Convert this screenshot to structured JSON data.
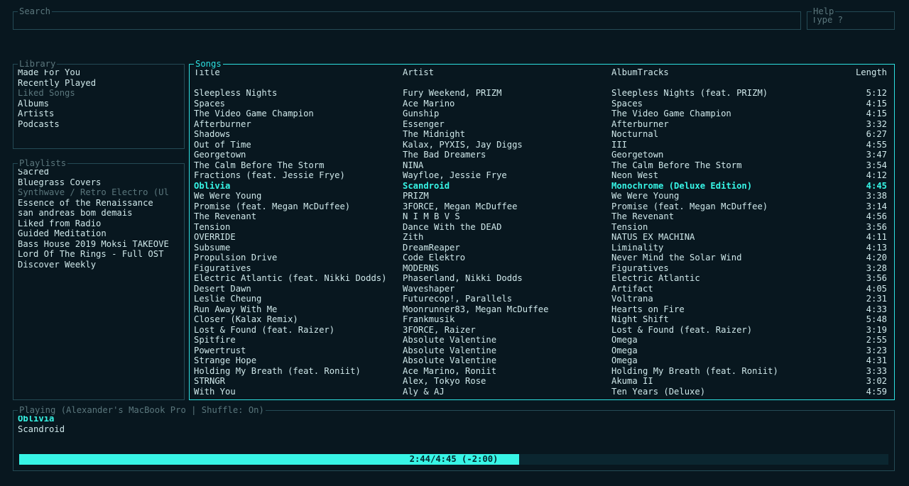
{
  "search": {
    "title": "Search",
    "value": ""
  },
  "help": {
    "title": "Help",
    "hint": "Type ?"
  },
  "library": {
    "title": "Library",
    "selected_index": 2,
    "items": [
      "Made For You",
      "Recently Played",
      "Liked Songs",
      "Albums",
      "Artists",
      "Podcasts"
    ]
  },
  "playlists": {
    "title": "Playlists",
    "selected_index": 2,
    "items": [
      "Sacred",
      "Bluegrass Covers",
      "Synthwave / Retro Electro (Ul",
      "Essence of the Renaissance",
      "san andreas bom demais",
      "Liked from Radio",
      "Guided Meditation",
      "Bass House 2019 Moksi TAKEOVE",
      "Lord Of The Rings - Full OST",
      "Discover Weekly"
    ]
  },
  "songs": {
    "title": "Songs",
    "headers": {
      "title": "Title",
      "artist": "Artist",
      "album": "AlbumTracks",
      "length": "Length"
    },
    "highlight_index": 9,
    "rows": [
      {
        "title": "Sleepless Nights",
        "artist": "Fury Weekend, PRIZM",
        "album": "Sleepless Nights (feat. PRIZM)",
        "length": "5:12"
      },
      {
        "title": "Spaces",
        "artist": "Ace Marino",
        "album": "Spaces",
        "length": "4:15"
      },
      {
        "title": "The Video Game Champion",
        "artist": "Gunship",
        "album": "The Video Game Champion",
        "length": "4:15"
      },
      {
        "title": "Afterburner",
        "artist": "Essenger",
        "album": "Afterburner",
        "length": "3:32"
      },
      {
        "title": "Shadows",
        "artist": "The Midnight",
        "album": "Nocturnal",
        "length": "6:27"
      },
      {
        "title": "Out of Time",
        "artist": "Kalax, PYXIS, Jay Diggs",
        "album": "III",
        "length": "4:55"
      },
      {
        "title": "Georgetown",
        "artist": "The Bad Dreamers",
        "album": "Georgetown",
        "length": "3:47"
      },
      {
        "title": "The Calm Before The Storm",
        "artist": "NINA",
        "album": "The Calm Before The Storm",
        "length": "3:54"
      },
      {
        "title": "Fractions (feat. Jessie Frye)",
        "artist": "Wayfloe, Jessie Frye",
        "album": "Neon West",
        "length": "4:12"
      },
      {
        "title": "Oblivia",
        "artist": "Scandroid",
        "album": "Monochrome (Deluxe Edition)",
        "length": "4:45"
      },
      {
        "title": "We Were Young",
        "artist": "PRIZM",
        "album": "We Were Young",
        "length": "3:38"
      },
      {
        "title": "Promise (feat. Megan McDuffee)",
        "artist": "3FORCE, Megan McDuffee",
        "album": "Promise (feat. Megan McDuffee)",
        "length": "3:14"
      },
      {
        "title": "The Revenant",
        "artist": "N I M B V S",
        "album": "The Revenant",
        "length": "4:56"
      },
      {
        "title": "Tension",
        "artist": "Dance With the DEAD",
        "album": "Tension",
        "length": "3:56"
      },
      {
        "title": "OVERRIDE",
        "artist": "Zith",
        "album": "NATUS EX MACHINA",
        "length": "4:11"
      },
      {
        "title": "Subsume",
        "artist": "DreamReaper",
        "album": "Liminality",
        "length": "4:13"
      },
      {
        "title": "Propulsion Drive",
        "artist": "Code Elektro",
        "album": "Never Mind the Solar Wind",
        "length": "4:20"
      },
      {
        "title": "Figuratives",
        "artist": "MODERNS",
        "album": "Figuratives",
        "length": "3:28"
      },
      {
        "title": "Electric Atlantic (feat. Nikki Dodds)",
        "artist": "Phaserland, Nikki Dodds",
        "album": "Electric Atlantic",
        "length": "3:56"
      },
      {
        "title": "Desert Dawn",
        "artist": "Waveshaper",
        "album": "Artifact",
        "length": "4:05"
      },
      {
        "title": "Leslie Cheung",
        "artist": "Futurecop!, Parallels",
        "album": "Voltrana",
        "length": "2:31"
      },
      {
        "title": "Run Away With Me",
        "artist": "Moonrunner83, Megan McDuffee",
        "album": "Hearts on Fire",
        "length": "4:33"
      },
      {
        "title": "Closer (Kalax Remix)",
        "artist": "Frankmusik",
        "album": "Night Shift",
        "length": "5:48"
      },
      {
        "title": "Lost & Found (feat. Raizer)",
        "artist": "3FORCE, Raizer",
        "album": "Lost & Found (feat. Raizer)",
        "length": "3:19"
      },
      {
        "title": "Spitfire",
        "artist": "Absolute Valentine",
        "album": "Omega",
        "length": "2:55"
      },
      {
        "title": "Powertrust",
        "artist": "Absolute Valentine",
        "album": "Omega",
        "length": "3:23"
      },
      {
        "title": "Strange Hope",
        "artist": "Absolute Valentine",
        "album": "Omega",
        "length": "4:31"
      },
      {
        "title": "Holding My Breath (feat. Roniit)",
        "artist": "Ace Marino, Roniit",
        "album": "Holding My Breath (feat. Roniit)",
        "length": "3:33"
      },
      {
        "title": "STRNGR",
        "artist": "Alex, Tokyo Rose",
        "album": "Akuma II",
        "length": "3:02"
      },
      {
        "title": "With You",
        "artist": "Aly & AJ",
        "album": "Ten Years (Deluxe)",
        "length": "4:59"
      }
    ]
  },
  "playing": {
    "title": "Playing (Alexander's MacBook Pro | Shuffle: On)",
    "track": "Oblivia",
    "artist": "Scandroid",
    "elapsed": "2:44",
    "total": "4:45",
    "remaining": "-2:00",
    "progress_pct": 57.5
  }
}
